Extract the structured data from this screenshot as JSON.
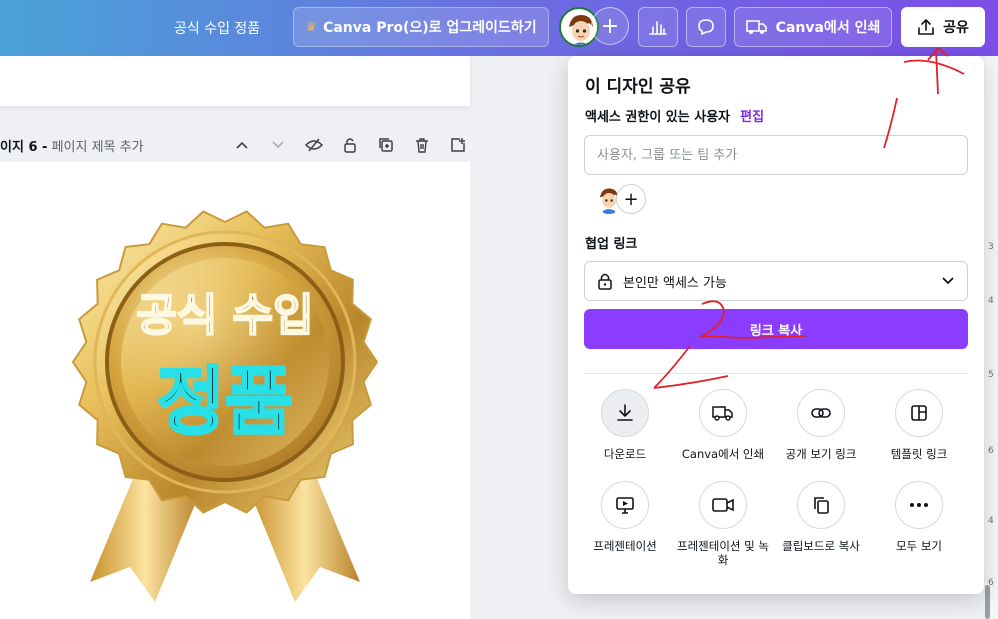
{
  "topbar": {
    "doc_title": "공식 수입 정품",
    "pro_button": "Canva Pro(으)로 업그레이드하기",
    "print_button": "Canva에서 인쇄",
    "share_button": "공유"
  },
  "page": {
    "label_prefix": "이지 6 -",
    "label_rest": "페이지 제목 추가"
  },
  "badge": {
    "line1": "공식 수입",
    "line2": "정품"
  },
  "share_panel": {
    "title": "이 디자인 공유",
    "access_label": "액세스 권한이 있는 사용자",
    "edit_link": "편집",
    "user_input_placeholder": "사용자, 그룹 또는 팀 추가",
    "collab_label": "협업 링크",
    "access_value": "본인만 액세스 가능",
    "copy_link_button": "링크 복사",
    "options": [
      {
        "label": "다운로드",
        "icon": "download-icon"
      },
      {
        "label": "Canva에서 인쇄",
        "icon": "truck-icon"
      },
      {
        "label": "공개 보기 링크",
        "icon": "link-icon"
      },
      {
        "label": "템플릿 링크",
        "icon": "template-icon"
      },
      {
        "label": "프레젠테이션",
        "icon": "present-icon"
      },
      {
        "label": "프레젠테이션 및 녹화",
        "icon": "camera-icon"
      },
      {
        "label": "클립보드로 복사",
        "icon": "copy-icon"
      },
      {
        "label": "모두 보기",
        "icon": "more-icon"
      }
    ]
  },
  "ruler": {
    "numbers": [
      "3",
      "4",
      "5",
      "6",
      "4",
      "6"
    ]
  },
  "colors": {
    "accent": "#8b3dff",
    "annotation": "#e0202a"
  }
}
